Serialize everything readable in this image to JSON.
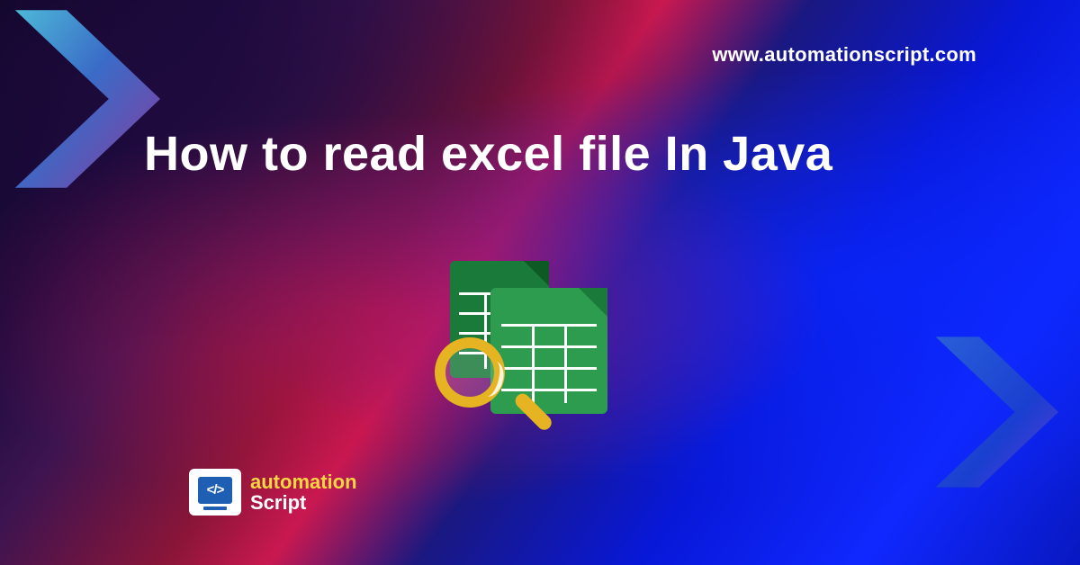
{
  "url": "www.automationscript.com",
  "title": "How to read excel file In Java",
  "logo": {
    "code_glyph": "</>",
    "line1": "automation",
    "line2": "Script"
  },
  "icons": {
    "chevron_left": "chevron-right-icon",
    "chevron_right": "chevron-right-icon",
    "main": "spreadsheet-search-icon",
    "magnifier": "magnifier-icon"
  },
  "colors": {
    "accent_yellow": "#f5d742",
    "magnifier": "#e6b422",
    "sheet_green_front": "#2d9c4f",
    "sheet_green_back": "#1a7a3a",
    "logo_blue": "#1e5fb3"
  }
}
